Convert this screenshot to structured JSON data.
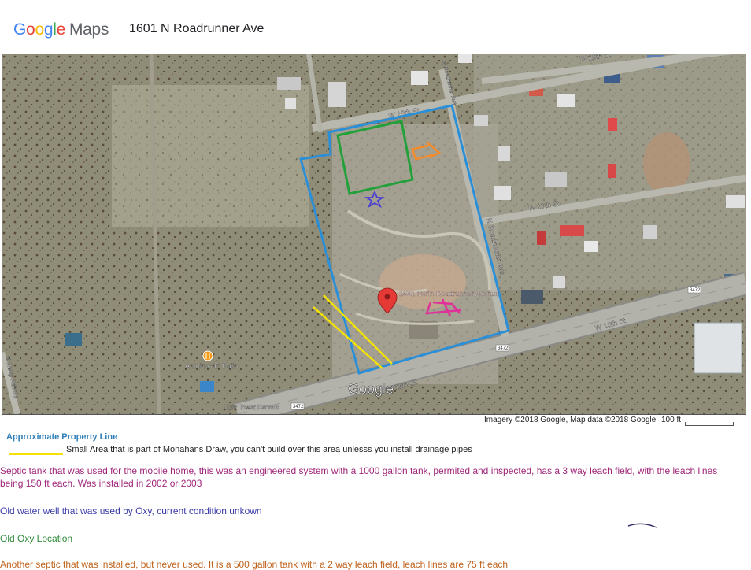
{
  "header": {
    "logo_google": "Google",
    "logo_maps": "Maps",
    "address": "1601 N Roadrunner Ave"
  },
  "map": {
    "streets": {
      "w18th": "W 18th St",
      "w19th": "W 19th St",
      "w17th": "W 17th St",
      "w16th_east": "W 16th St",
      "w16th_south": "W 16th St",
      "n_roadrunner": "N Roadrunner Ave",
      "n_roadrunner_top": "N Roadrunner Ave",
      "highway_shield_1": "3472",
      "highway_shield_2": "3472",
      "highway_shield_3": "3472",
      "left_road": "N Hoop Rd Ave"
    },
    "places": {
      "pin_label": "1601 North Roadrunner Avenue",
      "restaurant": "Antojitos El Bajio",
      "rentals": "Light Tower Rentals"
    },
    "watermark": "Google",
    "colors": {
      "property_line": "#2b8fd8",
      "drainage": "#f5e300",
      "septic_used": "#e0309a",
      "well": "#4a3fd4",
      "oxy_location": "#22a03a",
      "septic_unused": "#f28b2c",
      "pin": "#e53935"
    }
  },
  "attribution": "Imagery ©2018 Google, Map data ©2018 Google",
  "scale_label": "100 ft",
  "legend": {
    "property": "Approximate Property Line",
    "drainage": "Small Area that is part of Monahans Draw, you can't build over this area unlesss you install drainage pipes",
    "septic_used": "Septic tank that was used for the mobile home,  this was an engineered system with a 1000 gallon tank, permited and inspected, has a 3 way leach field, with the leach lines being 150 ft each.  Was installed in 2002 or 2003",
    "well": "Old water well that was used by Oxy, current condition unkown",
    "oxy": "Old Oxy Location",
    "septic_unused": "Another septic that was installed, but never used.  It is a 500 gallon tank with a 2 way leach field, leach lines are 75 ft each"
  }
}
